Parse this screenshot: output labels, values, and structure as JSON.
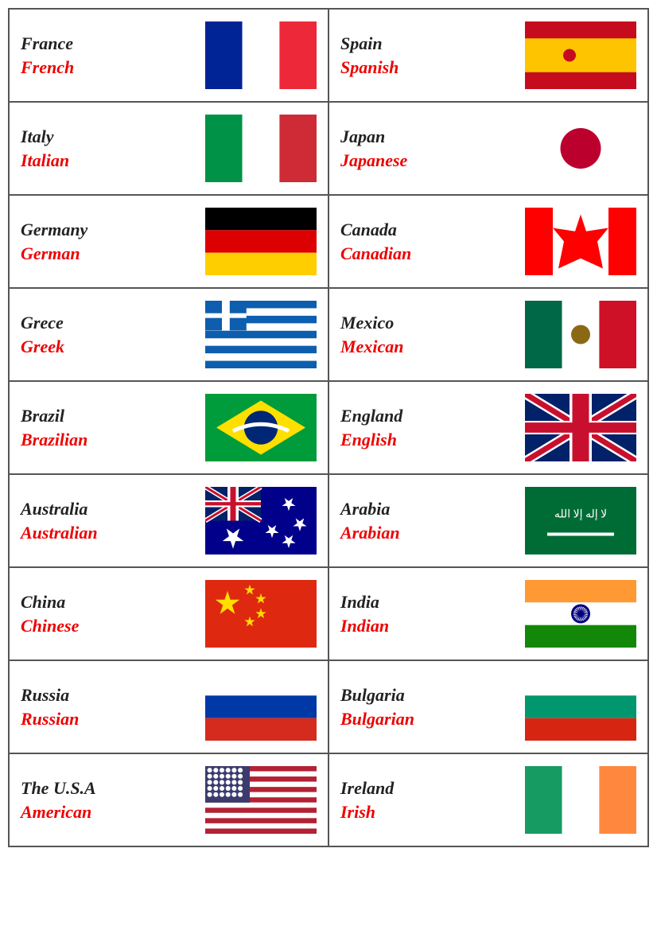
{
  "rows": [
    {
      "cells": [
        {
          "country": "France",
          "language": "French",
          "flag": "france"
        },
        {
          "country": "Spain",
          "language": "Spanish",
          "flag": "spain"
        }
      ]
    },
    {
      "cells": [
        {
          "country": "Italy",
          "language": "Italian",
          "flag": "italy"
        },
        {
          "country": "Japan",
          "language": "Japanese",
          "flag": "japan"
        }
      ]
    },
    {
      "cells": [
        {
          "country": "Germany",
          "language": "German",
          "flag": "germany"
        },
        {
          "country": "Canada",
          "language": "Canadian",
          "flag": "canada"
        }
      ]
    },
    {
      "cells": [
        {
          "country": "Grece",
          "language": "Greek",
          "flag": "greece"
        },
        {
          "country": "Mexico",
          "language": "Mexican",
          "flag": "mexico"
        }
      ]
    },
    {
      "cells": [
        {
          "country": "Brazil",
          "language": "Brazilian",
          "flag": "brazil"
        },
        {
          "country": "England",
          "language": "English",
          "flag": "england"
        }
      ]
    },
    {
      "cells": [
        {
          "country": "Australia",
          "language": "Australian",
          "flag": "australia"
        },
        {
          "country": "Arabia",
          "language": "Arabian",
          "flag": "arabia"
        }
      ]
    },
    {
      "cells": [
        {
          "country": "China",
          "language": "Chinese",
          "flag": "china"
        },
        {
          "country": "India",
          "language": "Indian",
          "flag": "india"
        }
      ]
    },
    {
      "cells": [
        {
          "country": "Russia",
          "language": "Russian",
          "flag": "russia"
        },
        {
          "country": "Bulgaria",
          "language": "Bulgarian",
          "flag": "bulgaria"
        }
      ]
    },
    {
      "cells": [
        {
          "country": "The U.S.A",
          "language": "American",
          "flag": "usa"
        },
        {
          "country": "Ireland",
          "language": "Irish",
          "flag": "ireland"
        }
      ]
    }
  ]
}
